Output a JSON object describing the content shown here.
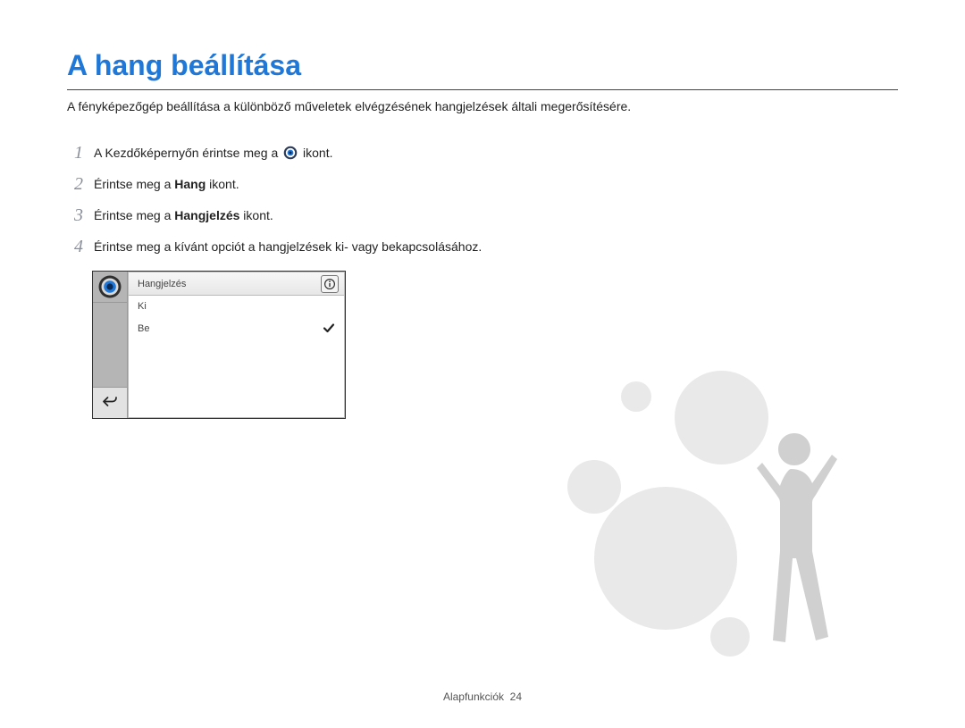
{
  "title": "A hang beállítása",
  "subtitle": "A fényképezőgép beállítása a különböző műveletek elvégzésének hangjelzések általi megerősítésére.",
  "steps": [
    {
      "num": "1",
      "before": "A Kezdőképernyőn érintse meg a ",
      "has_icon": true,
      "after": " ikont."
    },
    {
      "num": "2",
      "before": "Érintse meg a ",
      "bold": "Hang",
      "after": " ikont."
    },
    {
      "num": "3",
      "before": "Érintse meg a ",
      "bold": "Hangjelzés",
      "after": " ikont."
    },
    {
      "num": "4",
      "before": "Érintse meg a kívánt opciót a hangjelzések ki- vagy bekapcsolásához."
    }
  ],
  "device": {
    "header": "Hangjelzés",
    "options": [
      "Ki",
      "Be"
    ],
    "selected_index": 1
  },
  "footer": {
    "section": "Alapfunkciók",
    "page": "24"
  }
}
